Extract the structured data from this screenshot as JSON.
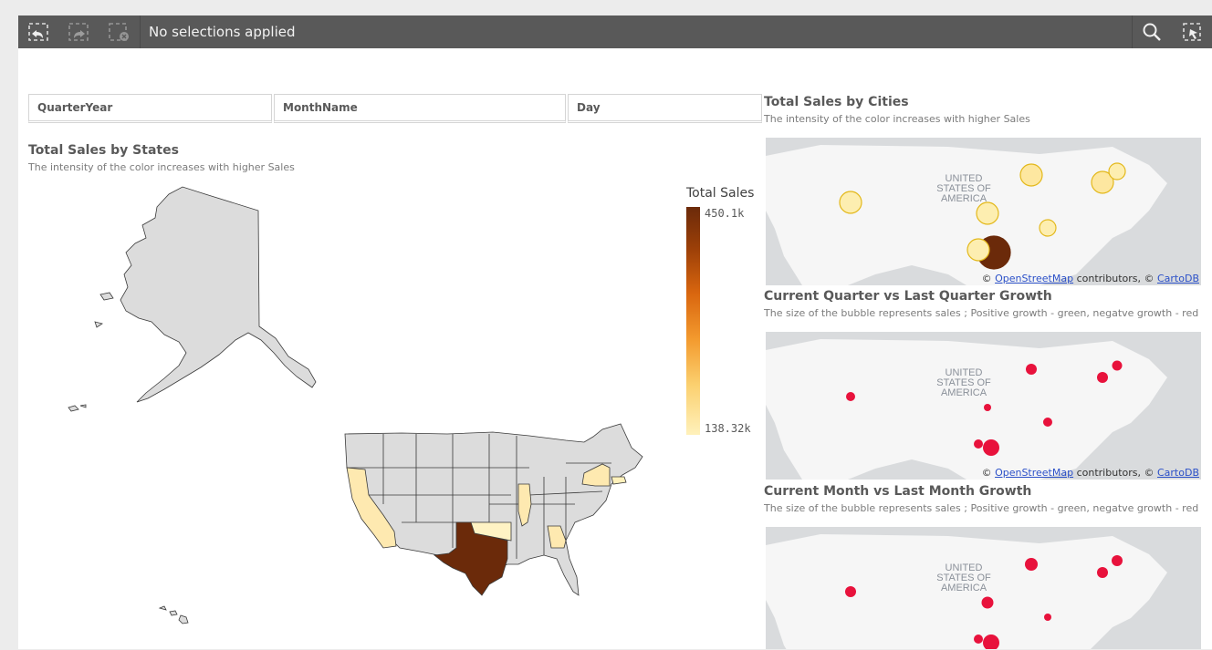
{
  "toolbar": {
    "status": "No selections applied",
    "icons": [
      "selections-back-icon",
      "selections-forward-icon",
      "clear-selections-icon",
      "search-icon",
      "smart-search-icon"
    ]
  },
  "filters": [
    "QuarterYear",
    "MonthName",
    "Day"
  ],
  "states_chart": {
    "title": "Total Sales by States",
    "subtitle": "The intensity of the color increases with higher Sales",
    "legend_title": "Total Sales",
    "legend_max": "450.1k",
    "legend_min": "138.32k",
    "highlighted_states": [
      "Texas",
      "California",
      "Illinois",
      "New York",
      "Georgia",
      "Oklahoma",
      "Massachusetts"
    ],
    "colors": {
      "high": "#6b2a0a",
      "low": "#fff1bb",
      "none": "#dcdcdc"
    }
  },
  "cities_map": {
    "title": "Total Sales by Cities",
    "subtitle": "The intensity of the color increases with higher Sales",
    "country_label": [
      "UNITED",
      "STATES OF",
      "AMERICA"
    ]
  },
  "quarter_map": {
    "title": "Current Quarter vs Last Quarter Growth",
    "subtitle": "The size of the bubble represents sales ; Positive growth - green, negatve growth - red",
    "country_label": [
      "UNITED",
      "STATES OF",
      "AMERICA"
    ]
  },
  "month_map": {
    "title": "Current Month vs Last Month Growth",
    "subtitle": "The size of the bubble represents sales ; Positive growth - green, negatve growth - red",
    "country_label": [
      "UNITED",
      "STATES OF",
      "AMERICA"
    ]
  },
  "attribution": {
    "prefix": "©",
    "osm": "OpenStreetMap",
    "middle": "contributors, ©",
    "carto": "CartoDB"
  }
}
